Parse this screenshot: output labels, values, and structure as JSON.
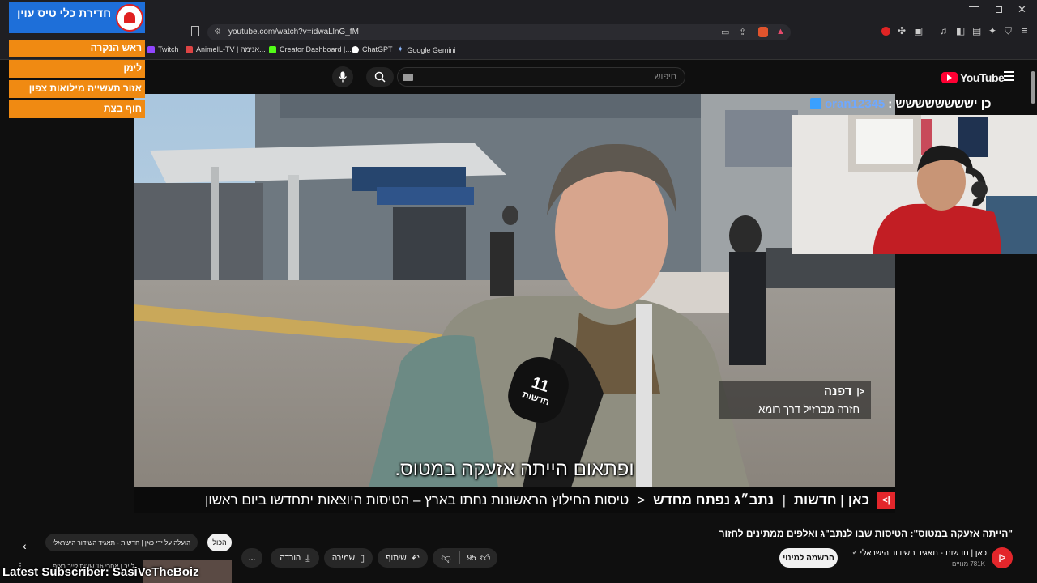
{
  "browser": {
    "url": "youtube.com/watch?v=idwaLlnG_fM",
    "bookmarks": [
      "Twitch",
      "AnimeIL-TV | אנימה...",
      "Creator Dashboard |...",
      "ChatGPT",
      "Google Gemini"
    ]
  },
  "youtube": {
    "logo_text": "YouTube",
    "search_placeholder": "חיפוש"
  },
  "news_overlay": {
    "title": "חדירת כלי טיס עוין",
    "items": [
      "ראש הנקרה",
      "לימן",
      "אזור תעשייה מילואות צפון",
      "חוף בצת"
    ]
  },
  "stream_chat": {
    "username": "oran12345",
    "message": "כן ישששששששש :"
  },
  "video": {
    "name_tag_name": "דפנה",
    "name_tag_sub": "חזרה מברזיל דרך רומא",
    "subtitle": "ופתאום הייתה אזעקה במטוס.",
    "ticker_brand": "כאן | חדשות",
    "ticker_section": "נתב״ג נפתח מחדש",
    "ticker_text": "טיסות החילוץ הראשונות נחתו בארץ – הטיסות היוצאות יתחדשו ביום ראשון",
    "mic_number": "11",
    "mic_label": "חדשות"
  },
  "video_info": {
    "title": "\"הייתה אזעקה במטוס\": הטיסות שבו לנתב\"ג ואלפים ממתינים לחזור",
    "channel_name": "כאן | חדשות - תאגיד השידור הישראלי",
    "subscribers": "781K מנויים",
    "subscribe_label": "הרשמה למינוי",
    "like_count": "95",
    "share_label": "שיתוף",
    "save_label": "שמירה",
    "download_label": "הורדה",
    "more_label": "..."
  },
  "related_bar": {
    "chip_all": "הכול",
    "chip_uploaded": "הועלה על ידי כאן | חדשות - תאגיד השידור הישראלי",
    "live_item": "לייב | אחרי 16 שעות לייב רצוף..."
  },
  "overlay_footer": {
    "latest_subscriber": "Latest Subscriber: SasiVeTheBoiz"
  }
}
